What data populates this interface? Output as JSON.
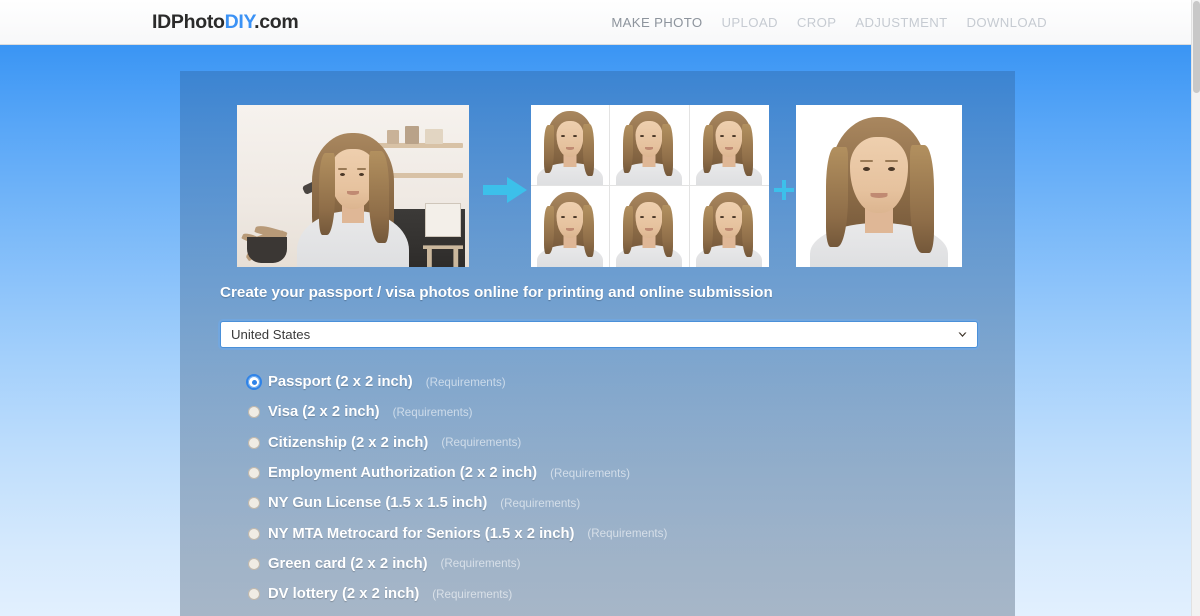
{
  "header": {
    "logo": {
      "part1": "IDPhoto",
      "part2": "DIY",
      "part3": ".com"
    },
    "nav": [
      {
        "label": "MAKE PHOTO",
        "active": true
      },
      {
        "label": "UPLOAD",
        "active": false
      },
      {
        "label": "CROP",
        "active": false
      },
      {
        "label": "ADJUSTMENT",
        "active": false
      },
      {
        "label": "DOWNLOAD",
        "active": false
      }
    ]
  },
  "main": {
    "heading": "Create your passport / visa photos online for printing and online submission",
    "photos": {
      "original_alt": "original-photo-woman-in-room",
      "printed_sheet_alt": "printed-sheet-6-passport-photos",
      "digital_alt": "digital-passport-photo",
      "arrow_icon": "arrow-right-icon",
      "plus_icon": "plus-icon",
      "sheet_rows": 2,
      "sheet_cols": 3
    },
    "country_select": {
      "value": "United States",
      "placeholder": "United States",
      "chevron_icon": "chevron-down-icon"
    },
    "requirements_label": "(Requirements)",
    "document_types": [
      {
        "label": "Passport (2 x 2 inch)",
        "requirements": "(Requirements)",
        "selected": true
      },
      {
        "label": "Visa (2 x 2 inch)",
        "requirements": "(Requirements)",
        "selected": false
      },
      {
        "label": "Citizenship (2 x 2 inch)",
        "requirements": "(Requirements)",
        "selected": false
      },
      {
        "label": "Employment Authorization (2 x 2 inch)",
        "requirements": "(Requirements)",
        "selected": false
      },
      {
        "label": "NY Gun License (1.5 x 1.5 inch)",
        "requirements": "(Requirements)",
        "selected": false
      },
      {
        "label": "NY MTA Metrocard for Seniors (1.5 x 2 inch)",
        "requirements": "(Requirements)",
        "selected": false
      },
      {
        "label": "Green card (2 x 2 inch)",
        "requirements": "(Requirements)",
        "selected": false
      },
      {
        "label": "DV lottery (2 x 2 inch)",
        "requirements": "(Requirements)",
        "selected": false
      }
    ]
  },
  "colors": {
    "brand_blue": "#3b92f5",
    "accent_cyan": "#3cc0ea",
    "page_top": "#3a95f4",
    "page_bottom": "#e2f0fe",
    "nav_inactive": "#c6cbd2",
    "nav_active": "#8d949d",
    "radio_selected": "#2f83e8"
  }
}
